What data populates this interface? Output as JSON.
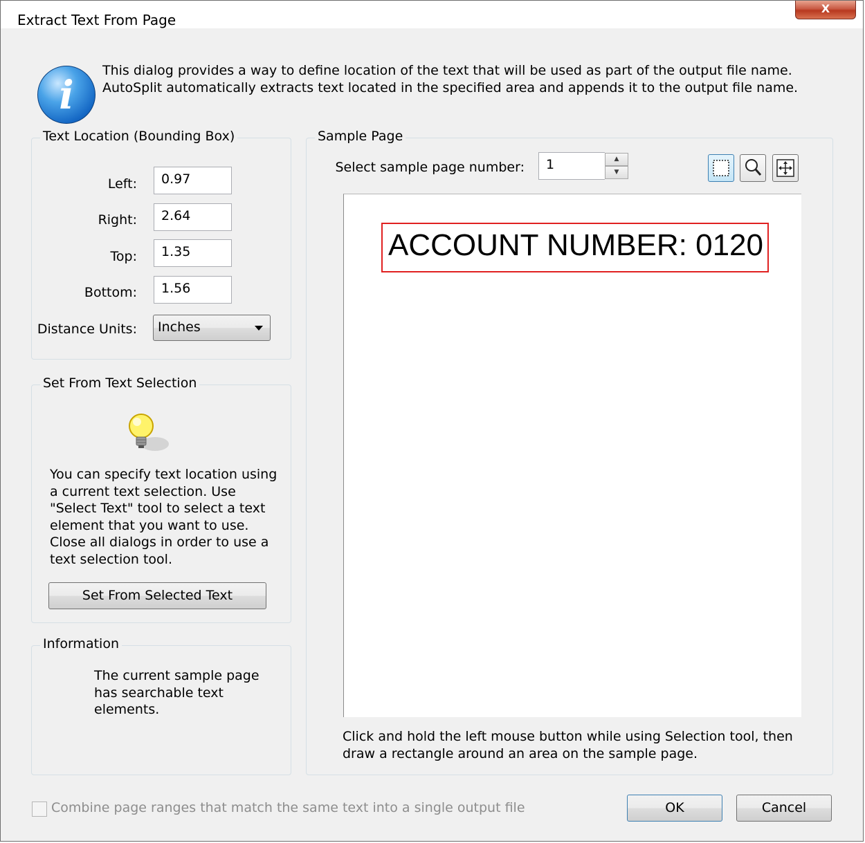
{
  "window": {
    "title": "Extract Text From Page",
    "close_label": "X"
  },
  "intro": {
    "icon": "info-icon",
    "text": "This dialog provides a way to define location of the text that will be used as part of the output file name. AutoSplit automatically extracts text located in the specified area and appends it to the output file name."
  },
  "text_location": {
    "legend": "Text Location (Bounding Box)",
    "left_label": "Left:",
    "left_value": "0.97",
    "right_label": "Right:",
    "right_value": "2.64",
    "top_label": "Top:",
    "top_value": "1.35",
    "bottom_label": "Bottom:",
    "bottom_value": "1.56",
    "units_label": "Distance Units:",
    "units_value": "Inches"
  },
  "set_from_selection": {
    "legend": "Set From Text Selection",
    "icon": "lightbulb-icon",
    "text": "You can specify text location using a current text selection.  Use \"Select Text\" tool to select a text element that you want to use. Close all dialogs in order to use a text selection tool.",
    "button_label": "Set From Selected Text"
  },
  "information": {
    "legend": "Information",
    "text": "The current sample page has searchable text elements."
  },
  "sample_page": {
    "legend": "Sample Page",
    "page_number_label": "Select sample page number:",
    "page_number_value": "1",
    "tools": [
      "selection-tool-icon",
      "zoom-tool-icon",
      "fit-page-tool-icon"
    ],
    "page_text": "ACCOUNT NUMBER: 0120",
    "hint": "Click and hold the left mouse button while using Selection tool, then draw a rectangle around an area on the sample page."
  },
  "footer": {
    "combine_label": "Combine page ranges that match the same text into a single output file",
    "combine_checked": false,
    "ok_label": "OK",
    "cancel_label": "Cancel"
  }
}
